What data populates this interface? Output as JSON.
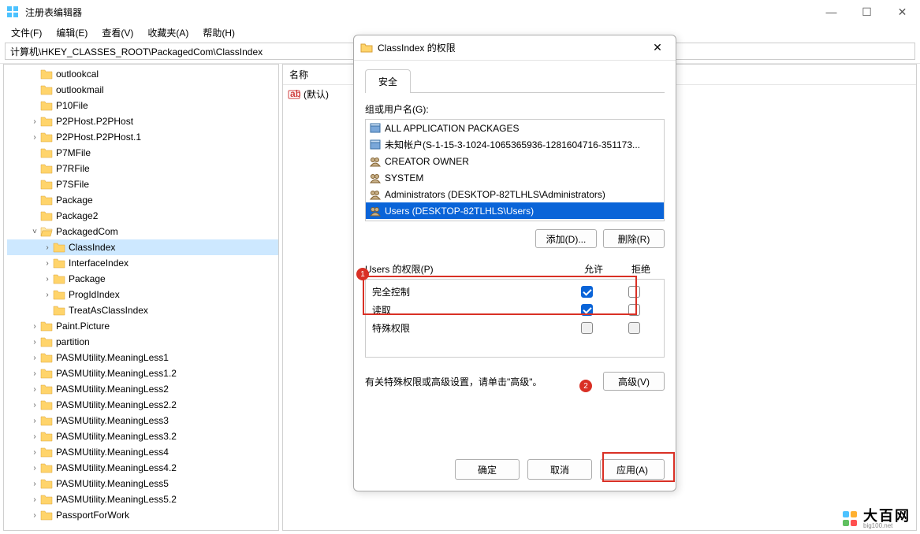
{
  "app": {
    "title": "注册表编辑器",
    "min": "—",
    "max": "☐",
    "close": "✕"
  },
  "menu": {
    "file": "文件(F)",
    "edit": "编辑(E)",
    "view": "查看(V)",
    "fav": "收藏夹(A)",
    "help": "帮助(H)"
  },
  "address": "计算机\\HKEY_CLASSES_ROOT\\PackagedCom\\ClassIndex",
  "values": {
    "col_name": "名称",
    "default_name": "(默认)"
  },
  "tree": {
    "items": [
      {
        "label": "outlookcal",
        "indent": 1,
        "exp": ""
      },
      {
        "label": "outlookmail",
        "indent": 1,
        "exp": ""
      },
      {
        "label": "P10File",
        "indent": 1,
        "exp": ""
      },
      {
        "label": "P2PHost.P2PHost",
        "indent": 1,
        "exp": ">"
      },
      {
        "label": "P2PHost.P2PHost.1",
        "indent": 1,
        "exp": ">"
      },
      {
        "label": "P7MFile",
        "indent": 1,
        "exp": ""
      },
      {
        "label": "P7RFile",
        "indent": 1,
        "exp": ""
      },
      {
        "label": "P7SFile",
        "indent": 1,
        "exp": ""
      },
      {
        "label": "Package",
        "indent": 1,
        "exp": ""
      },
      {
        "label": "Package2",
        "indent": 1,
        "exp": ""
      },
      {
        "label": "PackagedCom",
        "indent": 1,
        "exp": "v",
        "open": true
      },
      {
        "label": "ClassIndex",
        "indent": 2,
        "exp": ">",
        "selected": true
      },
      {
        "label": "InterfaceIndex",
        "indent": 2,
        "exp": ">"
      },
      {
        "label": "Package",
        "indent": 2,
        "exp": ">"
      },
      {
        "label": "ProgIdIndex",
        "indent": 2,
        "exp": ">"
      },
      {
        "label": "TreatAsClassIndex",
        "indent": 2,
        "exp": ""
      },
      {
        "label": "Paint.Picture",
        "indent": 1,
        "exp": ">"
      },
      {
        "label": "partition",
        "indent": 1,
        "exp": ">"
      },
      {
        "label": "PASMUtility.MeaningLess1",
        "indent": 1,
        "exp": ">"
      },
      {
        "label": "PASMUtility.MeaningLess1.2",
        "indent": 1,
        "exp": ">"
      },
      {
        "label": "PASMUtility.MeaningLess2",
        "indent": 1,
        "exp": ">"
      },
      {
        "label": "PASMUtility.MeaningLess2.2",
        "indent": 1,
        "exp": ">"
      },
      {
        "label": "PASMUtility.MeaningLess3",
        "indent": 1,
        "exp": ">"
      },
      {
        "label": "PASMUtility.MeaningLess3.2",
        "indent": 1,
        "exp": ">"
      },
      {
        "label": "PASMUtility.MeaningLess4",
        "indent": 1,
        "exp": ">"
      },
      {
        "label": "PASMUtility.MeaningLess4.2",
        "indent": 1,
        "exp": ">"
      },
      {
        "label": "PASMUtility.MeaningLess5",
        "indent": 1,
        "exp": ">"
      },
      {
        "label": "PASMUtility.MeaningLess5.2",
        "indent": 1,
        "exp": ">"
      },
      {
        "label": "PassportForWork",
        "indent": 1,
        "exp": ">"
      }
    ]
  },
  "dialog": {
    "title": "ClassIndex 的权限",
    "tab_security": "安全",
    "group_users_label": "组或用户名(G):",
    "users": [
      {
        "name": "ALL APPLICATION PACKAGES",
        "icon": "pkg"
      },
      {
        "name": "未知帐户(S-1-15-3-1024-1065365936-1281604716-351173...",
        "icon": "pkg"
      },
      {
        "name": "CREATOR OWNER",
        "icon": "grp"
      },
      {
        "name": "SYSTEM",
        "icon": "grp"
      },
      {
        "name": "Administrators (DESKTOP-82TLHLS\\Administrators)",
        "icon": "grp"
      },
      {
        "name": "Users (DESKTOP-82TLHLS\\Users)",
        "icon": "grp",
        "selected": true
      }
    ],
    "btn_add": "添加(D)...",
    "btn_remove": "删除(R)",
    "perm_label": "Users 的权限(P)",
    "col_allow": "允许",
    "col_deny": "拒绝",
    "perms": [
      {
        "name": "完全控制",
        "allow": true,
        "deny": false
      },
      {
        "name": "读取",
        "allow": true,
        "deny": false
      },
      {
        "name": "特殊权限",
        "allow": false,
        "deny": false,
        "disabled": true
      }
    ],
    "adv_text": "有关特殊权限或高级设置，请单击\"高级\"。",
    "btn_adv": "高级(V)",
    "btn_ok": "确定",
    "btn_cancel": "取消",
    "btn_apply": "应用(A)"
  },
  "annotations": {
    "badge1": "1",
    "badge2": "2"
  },
  "watermark": {
    "text": "大百网",
    "sub": "big100.net"
  }
}
